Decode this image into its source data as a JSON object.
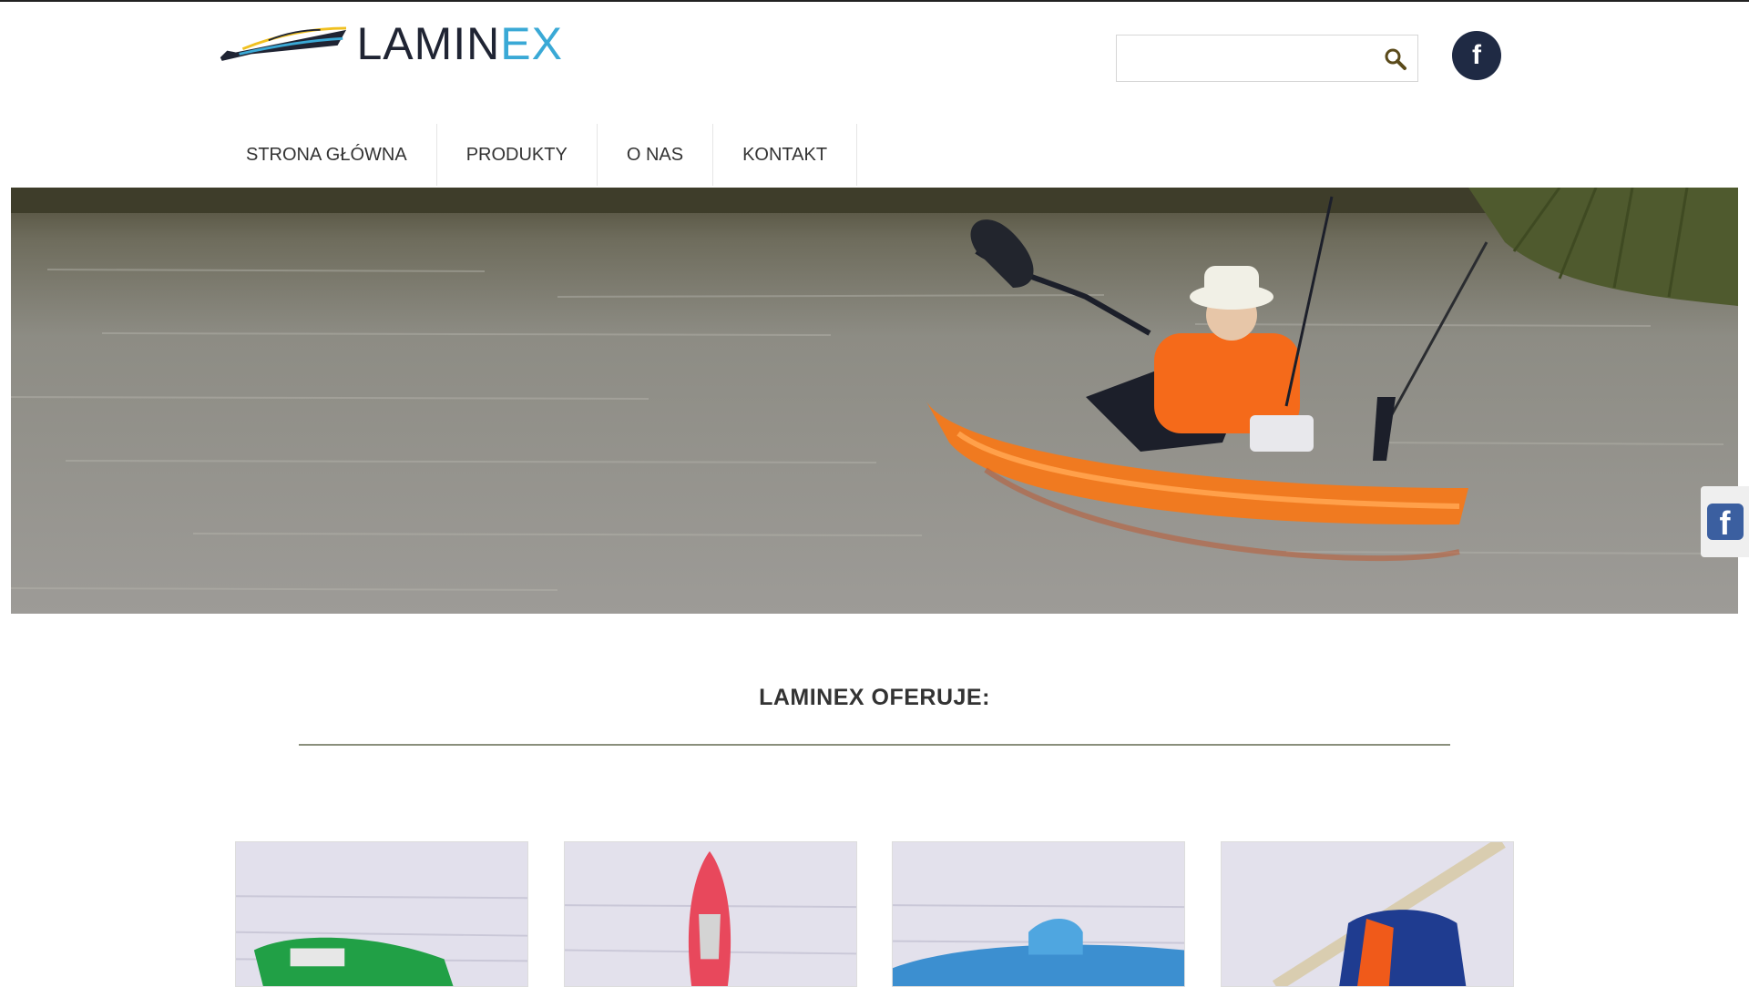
{
  "brand": {
    "name_part1": "LAMIN",
    "name_part2": "EX",
    "primary_color": "#1f2433",
    "accent_color": "#3aa9d6"
  },
  "header": {
    "search": {
      "value": "",
      "placeholder": ""
    },
    "social": {
      "facebook_icon": "facebook-icon",
      "letter": "f"
    }
  },
  "nav": {
    "items": [
      {
        "label": "STRONA GŁÓWNA"
      },
      {
        "label": "PRODUKTY"
      },
      {
        "label": "O NAS"
      },
      {
        "label": "KONTAKT"
      }
    ]
  },
  "hero": {
    "icon": "kayak-fisherman-photo"
  },
  "side_widget": {
    "icon": "facebook-icon",
    "letter": "f"
  },
  "offer": {
    "title": "LAMINEX OFERUJE:",
    "products": [
      {
        "icon": "green-boat-photo"
      },
      {
        "icon": "red-canoe-photo"
      },
      {
        "icon": "blue-pedalo-photo"
      },
      {
        "icon": "life-vest-paddle-photo"
      }
    ]
  }
}
